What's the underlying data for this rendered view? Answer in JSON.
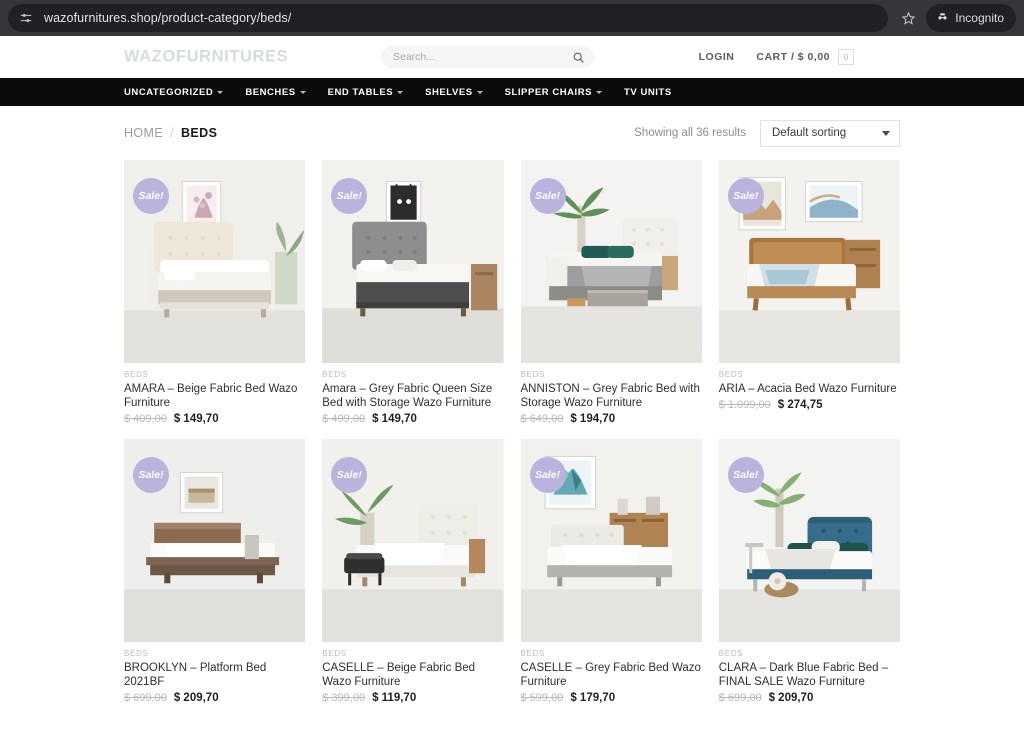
{
  "browser": {
    "url": "wazofurnitures.shop/product-category/beds/",
    "site_info_icon": "tune-icon",
    "bookmark_icon": "star-icon",
    "incognito_icon": "incognito-icon",
    "incognito_label": "Incognito"
  },
  "header": {
    "logo": "WAZOFURNITURES",
    "search": {
      "placeholder": "Search...",
      "value": "",
      "icon": "search-icon"
    },
    "login_label": "LOGIN",
    "cart_label": "CART / $ 0,00",
    "cart_count": "0"
  },
  "nav": {
    "items": [
      {
        "label": "UNCATEGORIZED",
        "has_caret": true
      },
      {
        "label": "BENCHES",
        "has_caret": true
      },
      {
        "label": "END TABLES",
        "has_caret": true
      },
      {
        "label": "SHELVES",
        "has_caret": true
      },
      {
        "label": "SLIPPER CHAIRS",
        "has_caret": true
      },
      {
        "label": "TV UNITS",
        "has_caret": false
      }
    ]
  },
  "breadcrumb": {
    "home": "HOME",
    "separator": "/",
    "current": "BEDS"
  },
  "toolbar": {
    "result_count": "Showing all 36 results",
    "sort_value": "Default sorting",
    "sort_options": [
      "Default sorting"
    ]
  },
  "products": [
    {
      "badge": "Sale!",
      "category": "BEDS",
      "title": "AMARA – Beige Fabric Bed Wazo Furniture",
      "price_old": "$ 409,00",
      "price_new": "$ 149,70",
      "image": "beige-tufted-bed"
    },
    {
      "badge": "Sale!",
      "category": "BEDS",
      "title": "Amara – Grey Fabric Queen Size Bed with Storage Wazo Furniture",
      "price_old": "$ 499,00",
      "price_new": "$ 149,70",
      "image": "grey-storage-bed"
    },
    {
      "badge": "Sale!",
      "category": "BEDS",
      "title": "ANNISTON – Grey Fabric Bed with Storage Wazo Furniture",
      "price_old": "$ 649,00",
      "price_new": "$ 194,70",
      "image": "grey-drawer-bed"
    },
    {
      "badge": "Sale!",
      "category": "BEDS",
      "title": "ARIA – Acacia Bed Wazo Furniture",
      "price_old": "$ 1.099,00",
      "price_new": "$ 274,75",
      "image": "acacia-wood-bed"
    },
    {
      "badge": "Sale!",
      "category": "BEDS",
      "title": "BROOKLYN – Platform Bed 2021BF",
      "price_old": "$ 699,00",
      "price_new": "$ 209,70",
      "image": "brooklyn-platform-bed"
    },
    {
      "badge": "Sale!",
      "category": "BEDS",
      "title": "CASELLE – Beige Fabric Bed Wazo Furniture",
      "price_old": "$ 399,00",
      "price_new": "$ 119,70",
      "image": "caselle-beige-bed"
    },
    {
      "badge": "Sale!",
      "category": "BEDS",
      "title": "CASELLE – Grey Fabric Bed Wazo Furniture",
      "price_old": "$ 599,00",
      "price_new": "$ 179,70",
      "image": "caselle-grey-bed"
    },
    {
      "badge": "Sale!",
      "category": "BEDS",
      "title": "CLARA – Dark Blue Fabric Bed – FINAL SALE Wazo Furniture",
      "price_old": "$ 699,00",
      "price_new": "$ 209,70",
      "image": "clara-dark-blue-bed"
    }
  ],
  "colors": {
    "nav_bg": "#0b0b0b",
    "sale_badge": "#b9b3dd",
    "logo": "#d6dbe0",
    "chrome_bg": "#35363a"
  }
}
